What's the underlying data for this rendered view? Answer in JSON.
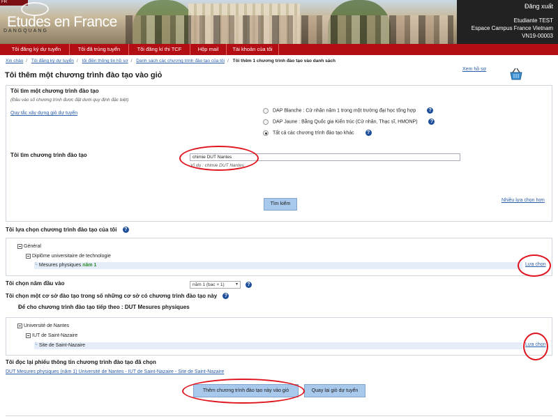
{
  "header": {
    "ribbon_text": "FR",
    "site_title": "Etudes en France",
    "watermark": "DANGQUANG",
    "logout": "Đăng xuất",
    "user_name": "Etudiante TEST",
    "campus": "Espace Campus France Vietnam",
    "user_code": "VN19-00003"
  },
  "menu": [
    {
      "label": "Tôi đăng ký dự tuyển"
    },
    {
      "label": "Tôi đã trúng tuyển"
    },
    {
      "label": "Tôi đăng kí thi TCF"
    },
    {
      "label": "Hộp mail"
    },
    {
      "label": "Tài khoản của tôi"
    }
  ],
  "breadcrumb": [
    {
      "label": "Xin chào"
    },
    {
      "label": "Tôi đăng ký dự tuyển"
    },
    {
      "label": "tôi điền thông tin hồ sơ"
    },
    {
      "label": "Danh sách các chương trình đào tạo của tôi"
    },
    {
      "label": "Tôi thêm 1 chương trình đào tạo vào danh sách"
    }
  ],
  "page": {
    "title": "Tôi thêm một chương trình đào tạo vào giỏ",
    "view_profile": "Xem hồ sơ",
    "basket_icon": "basket-icon"
  },
  "search": {
    "heading": "Tôi tìm một chương trình đào tạo",
    "note": "(Đầu vào số chương trình được đặt dưới quy định đặc biệt)",
    "rules_link": "Quy tắc xây dựng giỏ dự tuyển",
    "radio_options": [
      {
        "label": "DAP Blanche : Cử nhân năm 1 trong một trường đại học tổng hợp",
        "checked": false
      },
      {
        "label": "DAP Jaune : Bằng Quốc gia Kiến trúc (Cử nhân, Thạc sĩ, HMONP)",
        "checked": false
      },
      {
        "label": "Tất cả các chương trình đào tạo khác",
        "checked": true
      }
    ],
    "field_label": "Tôi tìm chương trình đào tạo",
    "field_value": "chimie DUT Nantes",
    "example": "Ví dụ : chimie DUT Nantes",
    "search_button": "Tìm kiếm",
    "more_options": "Nhiều lựa chọn hơn"
  },
  "my_choice": {
    "heading": "Tôi lựa chọn chương trình đào tạo của tôi",
    "tree": [
      {
        "label": "Général"
      },
      {
        "label": "Diplôme universitaire de technologie"
      },
      {
        "label": "Mesures physiques",
        "suffix": "năm 1"
      }
    ],
    "select_link": "Lựa chọn"
  },
  "entry_year": {
    "label": "Tôi chọn năm đầu vào",
    "value": "năm 1 (bac + 1)"
  },
  "institution": {
    "heading": "Tôi chọn một cơ sở đào tạo trong số những cơ sở có chương trình đào tạo này",
    "subheading": "Để cho chương trình đào tạo tiếp theo : DUT Mesures physiques",
    "tree": [
      {
        "label": "Université de Nantes"
      },
      {
        "label": "IUT de Saint-Nazaire"
      },
      {
        "label": "Site de Saint-Nazaire"
      }
    ],
    "select_link": "Lựa chọn"
  },
  "review": {
    "heading": "Tôi đọc lại phiếu thông tin chương trình đào tạo đã chọn",
    "summary_link": "DUT Mesures physiques (năm 1) Université de Nantes - IUT de Saint-Nazaire - Site de Saint-Nazaire",
    "add_button": "Thêm chương trình đào tạo này vào giỏ",
    "back_button": "Quay lại giỏ dự tuyển"
  },
  "colors": {
    "menu_red": "#b30e14",
    "link_blue": "#2a5da8",
    "annotation_red": "#e0141e",
    "button_blue": "#a9c9ec"
  }
}
